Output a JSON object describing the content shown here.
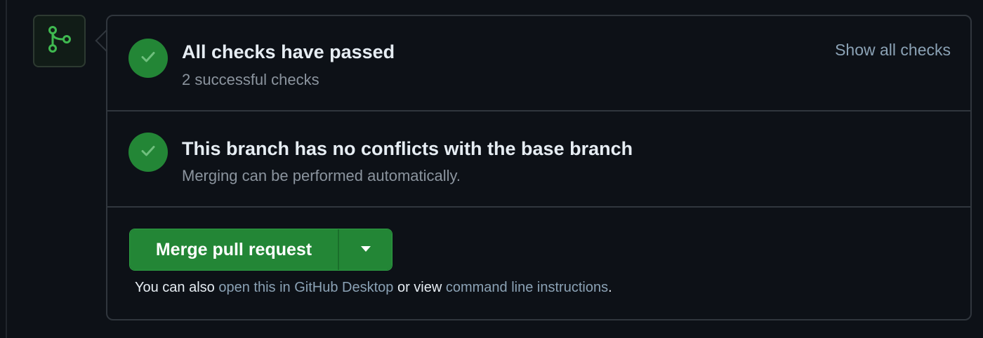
{
  "checks": {
    "title": "All checks have passed",
    "subtitle": "2 successful checks",
    "show_all_label": "Show all checks"
  },
  "conflicts": {
    "title": "This branch has no conflicts with the base branch",
    "subtitle": "Merging can be performed automatically."
  },
  "merge": {
    "button_label": "Merge pull request",
    "also_prefix": "You can also ",
    "desktop_link": "open this in GitHub Desktop",
    "middle_text": " or view ",
    "cli_link": "command line instructions",
    "suffix": "."
  },
  "icons": {
    "merge_badge": "git-merge-icon",
    "check": "check-icon",
    "caret": "triangle-down-icon"
  },
  "colors": {
    "success_green": "#238636",
    "link_muted": "#8ba2b5",
    "border": "#30363d",
    "background": "#0d1117"
  }
}
